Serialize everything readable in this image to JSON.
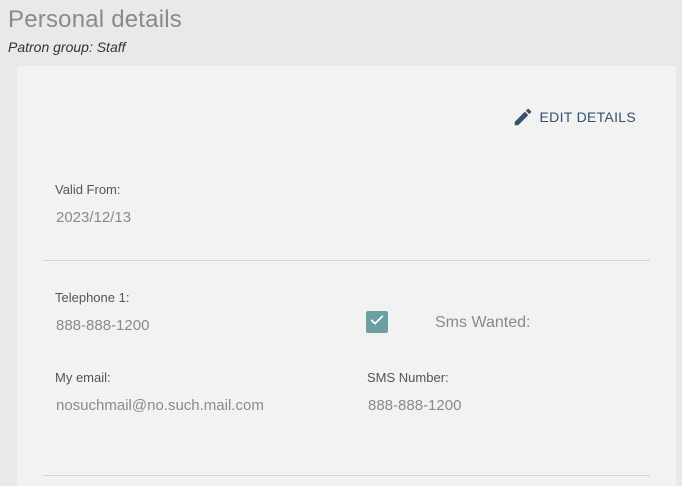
{
  "header": {
    "title": "Personal details",
    "patron_group": "Patron group: Staff"
  },
  "card": {
    "edit_label": "EDIT DETAILS",
    "valid_from_label": "Valid From:",
    "valid_from_value": "2023/12/13",
    "telephone_label": "Telephone 1:",
    "telephone_value": "888-888-1200",
    "sms_wanted_label": "Sms Wanted:",
    "sms_wanted_checked": true,
    "email_label": "My email:",
    "email_value": "nosuchmail@no.such.mail.com",
    "sms_number_label": "SMS Number:",
    "sms_number_value": "888-888-1200"
  },
  "colors": {
    "accent": "#34526e",
    "checkbox": "#6b9fa3"
  },
  "icons": {
    "edit": "pencil-icon",
    "check": "check-icon"
  }
}
